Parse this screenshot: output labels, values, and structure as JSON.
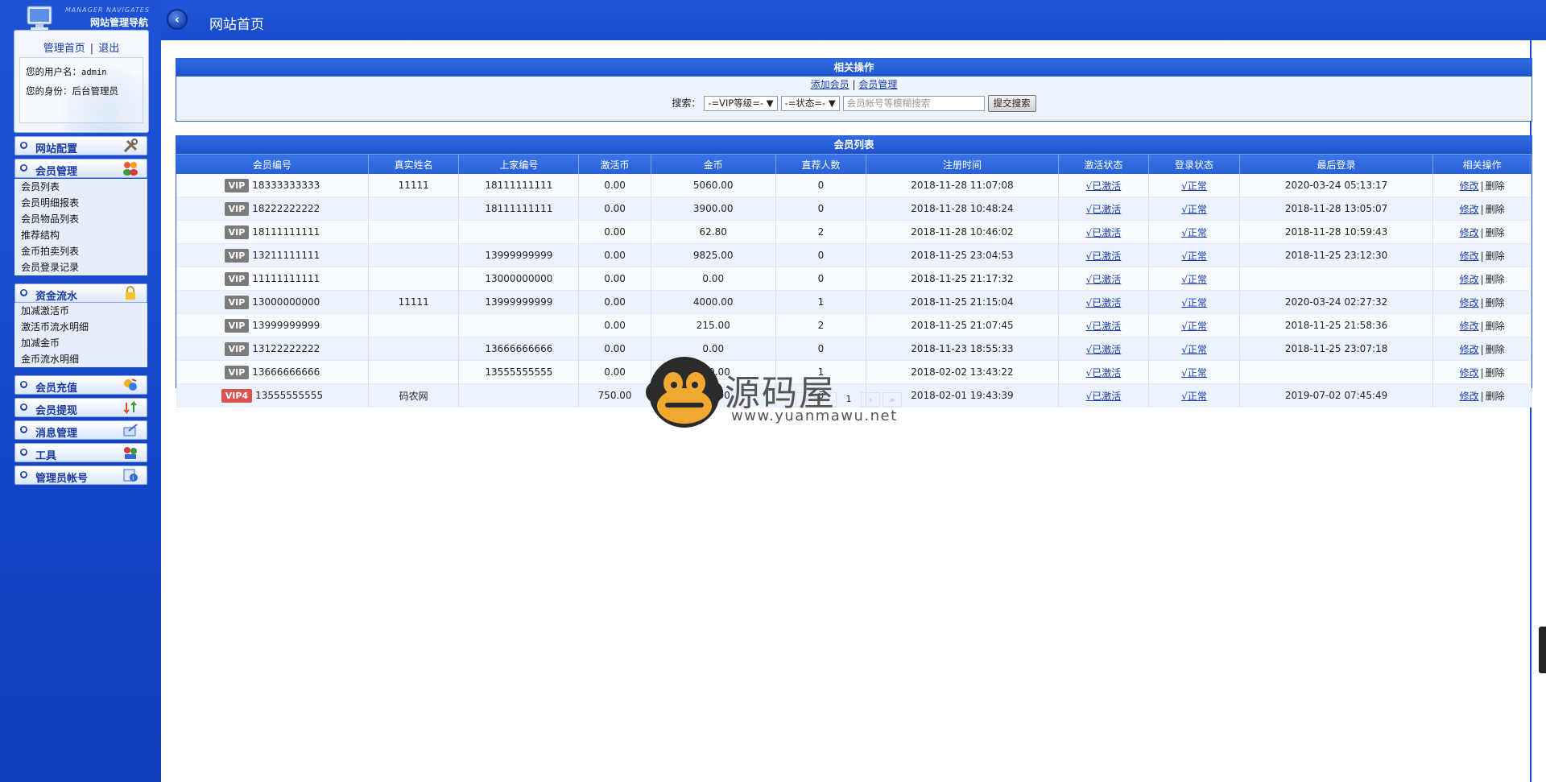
{
  "sidebar": {
    "brand_en": "MANAGER NAVIGATES",
    "brand_cn": "网站管理导航",
    "links": {
      "home": "管理首页",
      "separator": "|",
      "logout": "退出"
    },
    "username_label": "您的用户名：",
    "username": "admin",
    "role_label": "您的身份：",
    "role": "后台管理员",
    "menus": [
      {
        "label": "网站配置",
        "icon": "tools-icon"
      },
      {
        "label": "会员管理",
        "icon": "users-icon",
        "items": [
          "会员列表",
          "会员明细报表",
          "会员物品列表",
          "推荐结构",
          "金币拍卖列表",
          "会员登录记录"
        ]
      },
      {
        "label": "资金流水",
        "icon": "lock-icon",
        "items": [
          "加减激活币",
          "激活币流水明细",
          "加减金币",
          "金币流水明细"
        ]
      },
      {
        "label": "会员充值",
        "icon": "recharge-icon"
      },
      {
        "label": "会员提现",
        "icon": "withdraw-icon"
      },
      {
        "label": "消息管理",
        "icon": "message-icon"
      },
      {
        "label": "工具",
        "icon": "toolbox-icon"
      },
      {
        "label": "管理员帐号",
        "icon": "admin-account-icon"
      }
    ]
  },
  "header": {
    "back_icon": "chevron-left-icon",
    "title": "网站首页"
  },
  "ops_panel": {
    "title": "相关操作",
    "add_member": "添加会员",
    "sep": "|",
    "member_manage": "会员管理",
    "search_label": "搜索：",
    "vip_select": "-=VIP等级=-",
    "status_select": "-=状态=-",
    "search_placeholder": "会员帐号等模糊搜索",
    "submit": "提交搜索"
  },
  "member_list": {
    "title": "会员列表",
    "columns": [
      "会员编号",
      "真实姓名",
      "上家编号",
      "激活币",
      "金币",
      "直荐人数",
      "注册时间",
      "激活状态",
      "登录状态",
      "最后登录",
      "相关操作"
    ],
    "edit_label": "修改",
    "action_sep": "|",
    "delete_label": "删除",
    "rows": [
      {
        "vip": "VIP",
        "vip_color": "#7b7b7b",
        "id": "18333333333",
        "name": "11111",
        "parent": "18111111111",
        "active_coin": "0.00",
        "gold": "5060.00",
        "referrals": "0",
        "reg_time": "2018-11-28 11:07:08",
        "activation": "√已激活",
        "login_status": "√正常",
        "last_login": "2020-03-24 05:13:17"
      },
      {
        "vip": "VIP",
        "vip_color": "#7b7b7b",
        "id": "18222222222",
        "name": "",
        "parent": "18111111111",
        "active_coin": "0.00",
        "gold": "3900.00",
        "referrals": "0",
        "reg_time": "2018-11-28 10:48:24",
        "activation": "√已激活",
        "login_status": "√正常",
        "last_login": "2018-11-28 13:05:07"
      },
      {
        "vip": "VIP",
        "vip_color": "#7b7b7b",
        "id": "18111111111",
        "name": "",
        "parent": "",
        "active_coin": "0.00",
        "gold": "62.80",
        "referrals": "2",
        "reg_time": "2018-11-28 10:46:02",
        "activation": "√已激活",
        "login_status": "√正常",
        "last_login": "2018-11-28 10:59:43"
      },
      {
        "vip": "VIP",
        "vip_color": "#7b7b7b",
        "id": "13211111111",
        "name": "",
        "parent": "13999999999",
        "active_coin": "0.00",
        "gold": "9825.00",
        "referrals": "0",
        "reg_time": "2018-11-25 23:04:53",
        "activation": "√已激活",
        "login_status": "√正常",
        "last_login": "2018-11-25 23:12:30"
      },
      {
        "vip": "VIP",
        "vip_color": "#7b7b7b",
        "id": "11111111111",
        "name": "",
        "parent": "13000000000",
        "active_coin": "0.00",
        "gold": "0.00",
        "referrals": "0",
        "reg_time": "2018-11-25 21:17:32",
        "activation": "√已激活",
        "login_status": "√正常",
        "last_login": ""
      },
      {
        "vip": "VIP",
        "vip_color": "#7b7b7b",
        "id": "13000000000",
        "name": "11111",
        "parent": "13999999999",
        "active_coin": "0.00",
        "gold": "4000.00",
        "referrals": "1",
        "reg_time": "2018-11-25 21:15:04",
        "activation": "√已激活",
        "login_status": "√正常",
        "last_login": "2020-03-24 02:27:32"
      },
      {
        "vip": "VIP",
        "vip_color": "#7b7b7b",
        "id": "13999999999",
        "name": "",
        "parent": "",
        "active_coin": "0.00",
        "gold": "215.00",
        "referrals": "2",
        "reg_time": "2018-11-25 21:07:45",
        "activation": "√已激活",
        "login_status": "√正常",
        "last_login": "2018-11-25 21:58:36"
      },
      {
        "vip": "VIP",
        "vip_color": "#7b7b7b",
        "id": "13122222222",
        "name": "",
        "parent": "13666666666",
        "active_coin": "0.00",
        "gold": "0.00",
        "referrals": "0",
        "reg_time": "2018-11-23 18:55:33",
        "activation": "√已激活",
        "login_status": "√正常",
        "last_login": "2018-11-25 23:07:18"
      },
      {
        "vip": "VIP",
        "vip_color": "#7b7b7b",
        "id": "13666666666",
        "name": "",
        "parent": "13555555555",
        "active_coin": "0.00",
        "gold": "500.00",
        "referrals": "1",
        "reg_time": "2018-02-02 13:43:22",
        "activation": "√已激活",
        "login_status": "√正常",
        "last_login": ""
      },
      {
        "vip": "VIP4",
        "vip_color": "#d9534f",
        "id": "13555555555",
        "name": "码农网",
        "parent": "",
        "active_coin": "750.00",
        "gold": "950.00",
        "referrals": "0",
        "reg_time": "2018-02-01 19:43:39",
        "activation": "√已激活",
        "login_status": "√正常",
        "last_login": "2019-07-02 07:45:49"
      }
    ]
  },
  "pagination": {
    "first": "«",
    "prev": "‹",
    "current": "1",
    "next": "›",
    "last": "»"
  },
  "watermark": {
    "text": "源码屋",
    "url": "www.yuanmawu.net",
    "icon": "monkey-logo-icon"
  }
}
